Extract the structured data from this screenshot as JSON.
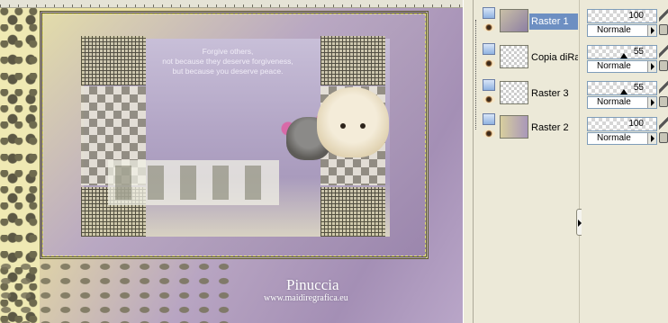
{
  "canvas": {
    "poem_lines": [
      "Forgive others,",
      "not because they deserve forgiveness,",
      "but because you deserve peace."
    ],
    "signature": "Pinuccia",
    "url": "www.maidiregrafica.eu"
  },
  "layers": [
    {
      "name": "Raster 1",
      "selected": true
    },
    {
      "name": "Copia diRas",
      "selected": false
    },
    {
      "name": "Raster 3",
      "selected": false
    },
    {
      "name": "Raster 2",
      "selected": false
    }
  ],
  "properties": [
    {
      "opacity": 100,
      "blend": "Normale"
    },
    {
      "opacity": 55,
      "blend": "Normale"
    },
    {
      "opacity": 55,
      "blend": "Normale"
    },
    {
      "opacity": 100,
      "blend": "Normale"
    }
  ],
  "icons": {
    "layer_toggle": "layer-toggle-icon",
    "visibility": "eye-icon",
    "brush": "brush-icon",
    "lock": "lock-icon"
  },
  "colors": {
    "selected_layer": "#6d8fc2",
    "panel_bg": "#ece9d8"
  }
}
